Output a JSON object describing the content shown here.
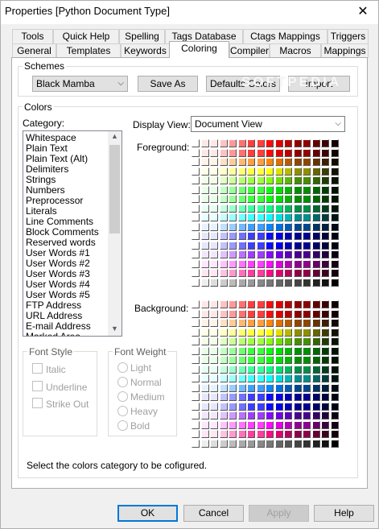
{
  "window": {
    "title": "Properties [Python Document Type]",
    "close_glyph": "✕"
  },
  "tabs_row1": [
    "Tools",
    "Quick Help",
    "Spelling",
    "Tags Database",
    "Ctags Mappings",
    "Triggers"
  ],
  "tabs_row2": [
    "General",
    "Templates",
    "Keywords",
    "Coloring",
    "Compiler",
    "Macros",
    "Mappings"
  ],
  "active_tab": "Coloring",
  "schemes": {
    "group_label": "Schemes",
    "selected": "Black Mamba",
    "save_as": "Save As",
    "defaults": "Defaults Colors",
    "import": "Import",
    "watermark": "SOFTPEDIA"
  },
  "colors": {
    "group_label": "Colors",
    "category_label": "Category:",
    "categories": [
      "Whitespace",
      "Plain Text",
      "Plain Text (Alt)",
      "Delimiters",
      "Strings",
      "Numbers",
      "Preprocessor",
      "Literals",
      "Line Comments",
      "Block Comments",
      "Reserved words",
      "User Words #1",
      "User Words #2",
      "User Words #3",
      "User Words #4",
      "User Words #5",
      "FTP Address",
      "URL Address",
      "E-mail Address",
      "Marked Area"
    ],
    "display_view_label": "Display View:",
    "display_view_value": "Document View",
    "foreground_label": "Foreground:",
    "background_label": "Background:",
    "hint": "Select the colors category to be cofigured."
  },
  "font_style": {
    "group_label": "Font Style",
    "options": [
      "Italic",
      "Underline",
      "Strike Out"
    ]
  },
  "font_weight": {
    "group_label": "Font Weight",
    "options": [
      "Light",
      "Normal",
      "Medium",
      "Heavy",
      "Bold"
    ]
  },
  "buttons": {
    "ok": "OK",
    "cancel": "Cancel",
    "apply": "Apply",
    "help": "Help"
  },
  "icons": {
    "dropdown": "chevron-down-icon",
    "scroll_up": "scroll-up-icon",
    "scroll_down": "scroll-down-icon"
  }
}
